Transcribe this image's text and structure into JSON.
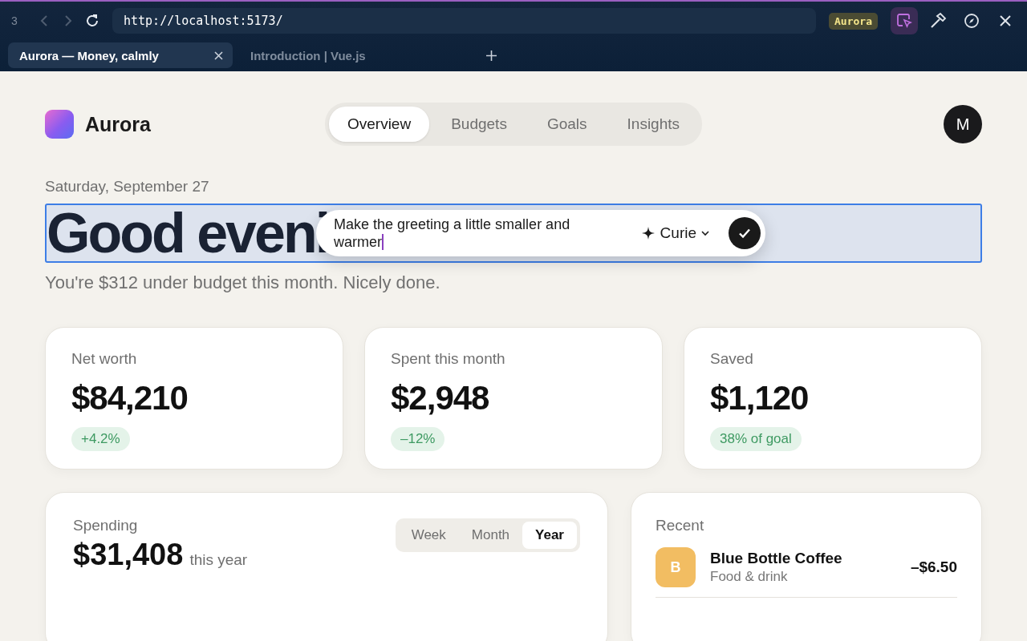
{
  "browser": {
    "tab_count": "3",
    "url": "http://localhost:5173/",
    "project_badge": "Aurora",
    "tabs": [
      {
        "label": "Aurora — Money, calmly",
        "selected": true
      },
      {
        "label": "Introduction | Vue.js",
        "selected": false
      }
    ]
  },
  "app": {
    "brand": "Aurora",
    "avatar": "M",
    "nav": [
      {
        "label": "Overview",
        "selected": true
      },
      {
        "label": "Budgets",
        "selected": false
      },
      {
        "label": "Goals",
        "selected": false
      },
      {
        "label": "Insights",
        "selected": false
      }
    ]
  },
  "date": "Saturday, September 27",
  "greeting": "Good eveni",
  "edit_prompt": {
    "value": "Make the greeting a little smaller and warmer",
    "model": "Curie"
  },
  "subtitle": "You're $312 under budget this month. Nicely done.",
  "stats": [
    {
      "label": "Net worth",
      "value": "$84,210",
      "badge": "+4.2%"
    },
    {
      "label": "Spent this month",
      "value": "$2,948",
      "badge": "–12%"
    },
    {
      "label": "Saved",
      "value": "$1,120",
      "badge": "38% of goal"
    }
  ],
  "spending": {
    "label": "Spending",
    "value": "$31,408",
    "suffix": "this year",
    "ranges": [
      {
        "label": "Week",
        "selected": false
      },
      {
        "label": "Month",
        "selected": false
      },
      {
        "label": "Year",
        "selected": true
      }
    ]
  },
  "recent": {
    "title": "Recent",
    "items": [
      {
        "initial": "B",
        "color": "#f2bd62",
        "name": "Blue Bottle Coffee",
        "category": "Food & drink",
        "amount": "–$6.50"
      }
    ]
  }
}
